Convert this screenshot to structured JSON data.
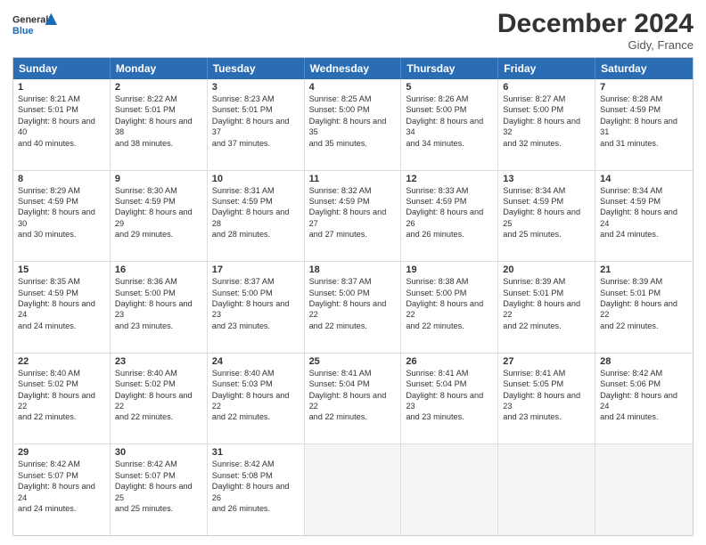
{
  "logo": {
    "general": "General",
    "blue": "Blue"
  },
  "title": "December 2024",
  "location": "Gidy, France",
  "days": [
    "Sunday",
    "Monday",
    "Tuesday",
    "Wednesday",
    "Thursday",
    "Friday",
    "Saturday"
  ],
  "weeks": [
    [
      {
        "day": "1",
        "sunrise": "8:21 AM",
        "sunset": "5:01 PM",
        "daylight": "8 hours and 40 minutes."
      },
      {
        "day": "2",
        "sunrise": "8:22 AM",
        "sunset": "5:01 PM",
        "daylight": "8 hours and 38 minutes."
      },
      {
        "day": "3",
        "sunrise": "8:23 AM",
        "sunset": "5:01 PM",
        "daylight": "8 hours and 37 minutes."
      },
      {
        "day": "4",
        "sunrise": "8:25 AM",
        "sunset": "5:00 PM",
        "daylight": "8 hours and 35 minutes."
      },
      {
        "day": "5",
        "sunrise": "8:26 AM",
        "sunset": "5:00 PM",
        "daylight": "8 hours and 34 minutes."
      },
      {
        "day": "6",
        "sunrise": "8:27 AM",
        "sunset": "5:00 PM",
        "daylight": "8 hours and 32 minutes."
      },
      {
        "day": "7",
        "sunrise": "8:28 AM",
        "sunset": "4:59 PM",
        "daylight": "8 hours and 31 minutes."
      }
    ],
    [
      {
        "day": "8",
        "sunrise": "8:29 AM",
        "sunset": "4:59 PM",
        "daylight": "8 hours and 30 minutes."
      },
      {
        "day": "9",
        "sunrise": "8:30 AM",
        "sunset": "4:59 PM",
        "daylight": "8 hours and 29 minutes."
      },
      {
        "day": "10",
        "sunrise": "8:31 AM",
        "sunset": "4:59 PM",
        "daylight": "8 hours and 28 minutes."
      },
      {
        "day": "11",
        "sunrise": "8:32 AM",
        "sunset": "4:59 PM",
        "daylight": "8 hours and 27 minutes."
      },
      {
        "day": "12",
        "sunrise": "8:33 AM",
        "sunset": "4:59 PM",
        "daylight": "8 hours and 26 minutes."
      },
      {
        "day": "13",
        "sunrise": "8:34 AM",
        "sunset": "4:59 PM",
        "daylight": "8 hours and 25 minutes."
      },
      {
        "day": "14",
        "sunrise": "8:34 AM",
        "sunset": "4:59 PM",
        "daylight": "8 hours and 24 minutes."
      }
    ],
    [
      {
        "day": "15",
        "sunrise": "8:35 AM",
        "sunset": "4:59 PM",
        "daylight": "8 hours and 24 minutes."
      },
      {
        "day": "16",
        "sunrise": "8:36 AM",
        "sunset": "5:00 PM",
        "daylight": "8 hours and 23 minutes."
      },
      {
        "day": "17",
        "sunrise": "8:37 AM",
        "sunset": "5:00 PM",
        "daylight": "8 hours and 23 minutes."
      },
      {
        "day": "18",
        "sunrise": "8:37 AM",
        "sunset": "5:00 PM",
        "daylight": "8 hours and 22 minutes."
      },
      {
        "day": "19",
        "sunrise": "8:38 AM",
        "sunset": "5:00 PM",
        "daylight": "8 hours and 22 minutes."
      },
      {
        "day": "20",
        "sunrise": "8:39 AM",
        "sunset": "5:01 PM",
        "daylight": "8 hours and 22 minutes."
      },
      {
        "day": "21",
        "sunrise": "8:39 AM",
        "sunset": "5:01 PM",
        "daylight": "8 hours and 22 minutes."
      }
    ],
    [
      {
        "day": "22",
        "sunrise": "8:40 AM",
        "sunset": "5:02 PM",
        "daylight": "8 hours and 22 minutes."
      },
      {
        "day": "23",
        "sunrise": "8:40 AM",
        "sunset": "5:02 PM",
        "daylight": "8 hours and 22 minutes."
      },
      {
        "day": "24",
        "sunrise": "8:40 AM",
        "sunset": "5:03 PM",
        "daylight": "8 hours and 22 minutes."
      },
      {
        "day": "25",
        "sunrise": "8:41 AM",
        "sunset": "5:04 PM",
        "daylight": "8 hours and 22 minutes."
      },
      {
        "day": "26",
        "sunrise": "8:41 AM",
        "sunset": "5:04 PM",
        "daylight": "8 hours and 23 minutes."
      },
      {
        "day": "27",
        "sunrise": "8:41 AM",
        "sunset": "5:05 PM",
        "daylight": "8 hours and 23 minutes."
      },
      {
        "day": "28",
        "sunrise": "8:42 AM",
        "sunset": "5:06 PM",
        "daylight": "8 hours and 24 minutes."
      }
    ],
    [
      {
        "day": "29",
        "sunrise": "8:42 AM",
        "sunset": "5:07 PM",
        "daylight": "8 hours and 24 minutes."
      },
      {
        "day": "30",
        "sunrise": "8:42 AM",
        "sunset": "5:07 PM",
        "daylight": "8 hours and 25 minutes."
      },
      {
        "day": "31",
        "sunrise": "8:42 AM",
        "sunset": "5:08 PM",
        "daylight": "8 hours and 26 minutes."
      },
      null,
      null,
      null,
      null
    ]
  ],
  "sunrise_label": "Sunrise:",
  "sunset_label": "Sunset:",
  "daylight_label": "Daylight:"
}
